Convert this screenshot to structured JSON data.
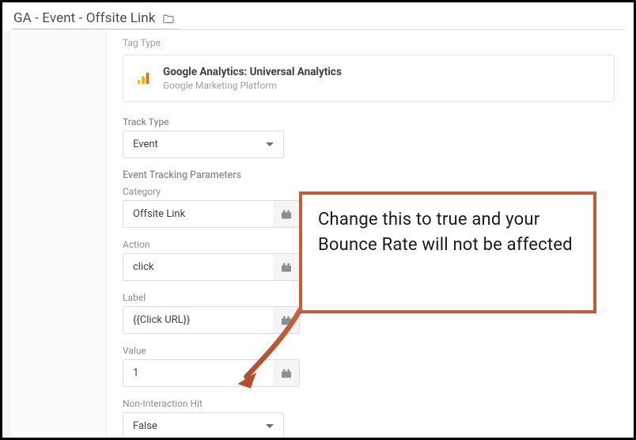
{
  "header": {
    "title": "GA - Event - Offsite Link"
  },
  "tagType": {
    "heading": "Tag Type",
    "card": {
      "title": "Google Analytics: Universal Analytics",
      "subtitle": "Google Marketing Platform"
    }
  },
  "trackType": {
    "label": "Track Type",
    "value": "Event"
  },
  "eventParams": {
    "heading": "Event Tracking Parameters",
    "category": {
      "label": "Category",
      "value": "Offsite Link"
    },
    "action": {
      "label": "Action",
      "value": "click"
    },
    "urlLabel": {
      "label": "Label",
      "value": "{{Click URL}}"
    },
    "value": {
      "label": "Value",
      "value": "1"
    }
  },
  "nonInteraction": {
    "label": "Non-Interaction Hit",
    "value": "False"
  },
  "annotation": {
    "text": "Change this to true and your Bounce Rate will not be affected"
  }
}
